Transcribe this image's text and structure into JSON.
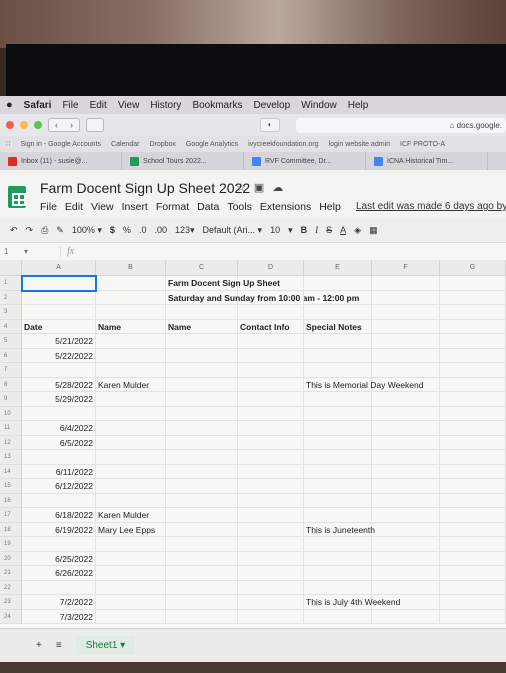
{
  "mac_menu": {
    "app": "Safari",
    "items": [
      "File",
      "Edit",
      "View",
      "History",
      "Bookmarks",
      "Develop",
      "Window",
      "Help"
    ]
  },
  "browser": {
    "url_text": "docs.google.",
    "bookmarks": [
      "Sign in - Google Accounts",
      "Calendar",
      "Dropbox",
      "Google Analytics",
      "ivycreekfoundation.org",
      "login website admin",
      "ICF PROTO-A"
    ],
    "tabs": [
      {
        "label": "Inbox (11) - susie@...",
        "icon": "gmail-icon",
        "color": "#d93025"
      },
      {
        "label": "School Tours 2022...",
        "icon": "sheets-icon",
        "color": "#1e9c5b"
      },
      {
        "label": "RVF Committee, Dr...",
        "icon": "docs-icon",
        "color": "#4285f4"
      },
      {
        "label": "ICNA Historical Tim...",
        "icon": "docs-icon",
        "color": "#4285f4"
      }
    ]
  },
  "doc": {
    "title": "Farm Docent Sign Up Sheet 2022",
    "menu": [
      "File",
      "Edit",
      "View",
      "Insert",
      "Format",
      "Data",
      "Tools",
      "Extensions",
      "Help"
    ],
    "last_edit": "Last edit was made 6 days ago by"
  },
  "format_toolbar": {
    "zoom": "100%",
    "currency": "$",
    "percent": "%",
    "dec_less": ".0",
    "dec_more": ".00",
    "number_format": "123",
    "font": "Default (Ari...",
    "font_size": "10",
    "bold": "B",
    "italic": "I",
    "strike": "S",
    "text_color": "A"
  },
  "formula_bar": {
    "cell_ref": "1",
    "fx": "fx"
  },
  "columns": [
    "A",
    "B",
    "C",
    "D",
    "E",
    "F",
    "G"
  ],
  "rows": [
    {
      "n": "1",
      "a": "",
      "b": "",
      "c": "Farm Docent Sign Up Sheet",
      "d": "",
      "e": ""
    },
    {
      "n": "2",
      "a": "",
      "b": "",
      "c": "Saturday and Sunday from 10:00 am - 12:00 pm",
      "d": "",
      "e": ""
    },
    {
      "n": "3",
      "a": "",
      "b": "",
      "c": "",
      "d": "",
      "e": ""
    },
    {
      "n": "4",
      "a": "Date",
      "b": "Name",
      "c": "Name",
      "d": "Contact Info",
      "e": "Special Notes"
    },
    {
      "n": "5",
      "a": "5/21/2022",
      "b": "",
      "c": "",
      "d": "",
      "e": ""
    },
    {
      "n": "6",
      "a": "5/22/2022",
      "b": "",
      "c": "",
      "d": "",
      "e": ""
    },
    {
      "n": "7",
      "a": "",
      "b": "",
      "c": "",
      "d": "",
      "e": ""
    },
    {
      "n": "8",
      "a": "5/28/2022",
      "b": "Karen Mulder",
      "c": "",
      "d": "",
      "e": "This is Memorial Day Weekend"
    },
    {
      "n": "9",
      "a": "5/29/2022",
      "b": "",
      "c": "",
      "d": "",
      "e": ""
    },
    {
      "n": "10",
      "a": "",
      "b": "",
      "c": "",
      "d": "",
      "e": ""
    },
    {
      "n": "11",
      "a": "6/4/2022",
      "b": "",
      "c": "",
      "d": "",
      "e": ""
    },
    {
      "n": "12",
      "a": "6/5/2022",
      "b": "",
      "c": "",
      "d": "",
      "e": ""
    },
    {
      "n": "13",
      "a": "",
      "b": "",
      "c": "",
      "d": "",
      "e": ""
    },
    {
      "n": "14",
      "a": "6/11/2022",
      "b": "",
      "c": "",
      "d": "",
      "e": ""
    },
    {
      "n": "15",
      "a": "6/12/2022",
      "b": "",
      "c": "",
      "d": "",
      "e": ""
    },
    {
      "n": "16",
      "a": "",
      "b": "",
      "c": "",
      "d": "",
      "e": ""
    },
    {
      "n": "17",
      "a": "6/18/2022",
      "b": "Karen Mulder",
      "c": "",
      "d": "",
      "e": ""
    },
    {
      "n": "18",
      "a": "6/19/2022",
      "b": "Mary Lee Epps",
      "c": "",
      "d": "",
      "e": "This is Juneteenth"
    },
    {
      "n": "19",
      "a": "",
      "b": "",
      "c": "",
      "d": "",
      "e": ""
    },
    {
      "n": "20",
      "a": "6/25/2022",
      "b": "",
      "c": "",
      "d": "",
      "e": ""
    },
    {
      "n": "21",
      "a": "6/26/2022",
      "b": "",
      "c": "",
      "d": "",
      "e": ""
    },
    {
      "n": "22",
      "a": "",
      "b": "",
      "c": "",
      "d": "",
      "e": ""
    },
    {
      "n": "23",
      "a": "7/2/2022",
      "b": "",
      "c": "",
      "d": "",
      "e": "This is July 4th Weekend"
    },
    {
      "n": "24",
      "a": "7/3/2022",
      "b": "",
      "c": "",
      "d": "",
      "e": ""
    }
  ],
  "sheet_tabs": {
    "add": "+",
    "list": "≡",
    "active": "Sheet1"
  }
}
